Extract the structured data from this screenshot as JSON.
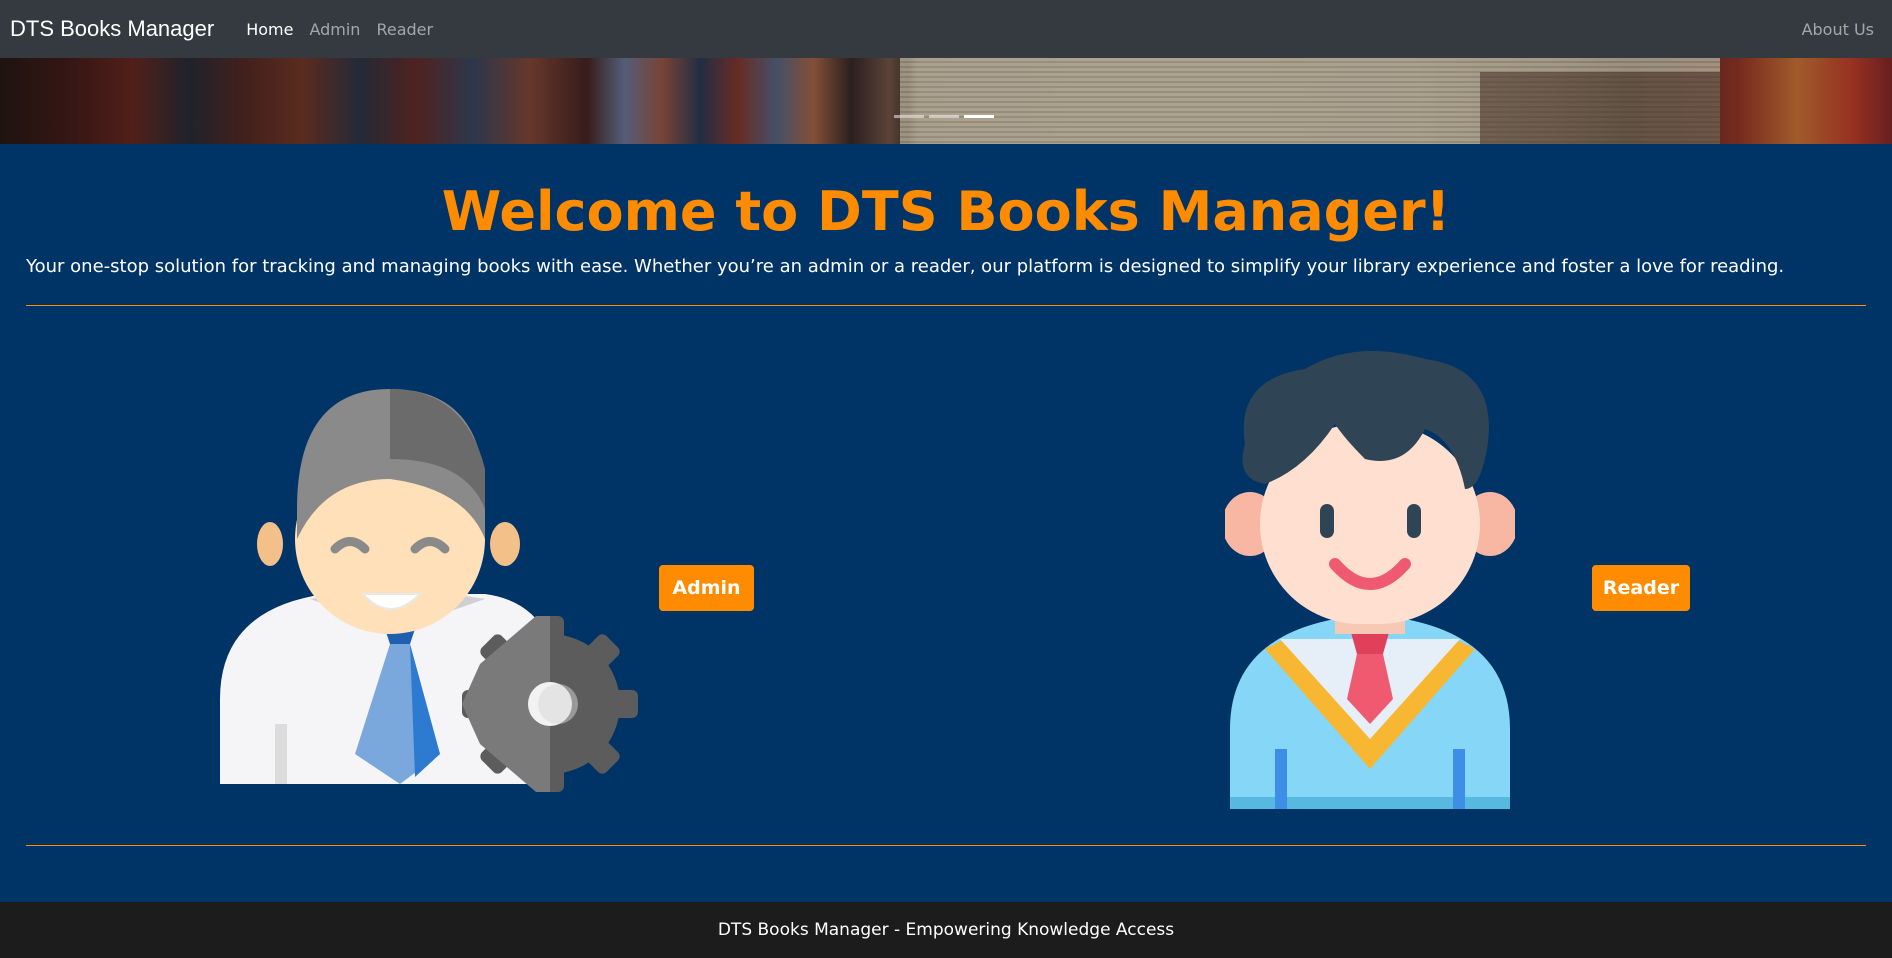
{
  "navbar": {
    "brand": "DTS Books Manager",
    "links": [
      "Home",
      "Admin",
      "Reader"
    ],
    "right_link": "About Us"
  },
  "carousel": {
    "indicator_count": 3,
    "active_index": 2
  },
  "main": {
    "title": "Welcome to DTS Books Manager!",
    "subtitle": "Your one-stop solution for tracking and managing books with ease. Whether you’re an admin or a reader, our platform is designed to simplify your library experience and foster a love for reading.",
    "admin_button": "Admin",
    "reader_button": "Reader"
  },
  "footer": {
    "text": "DTS Books Manager - Empowering Knowledge Access"
  },
  "colors": {
    "navbar_bg": "#343a40",
    "main_bg": "#003366",
    "accent": "#ff8c00",
    "footer_bg": "#1c1c1c"
  },
  "icons": {
    "admin_illustration": "admin-with-gear-avatar",
    "reader_illustration": "reader-student-avatar"
  }
}
